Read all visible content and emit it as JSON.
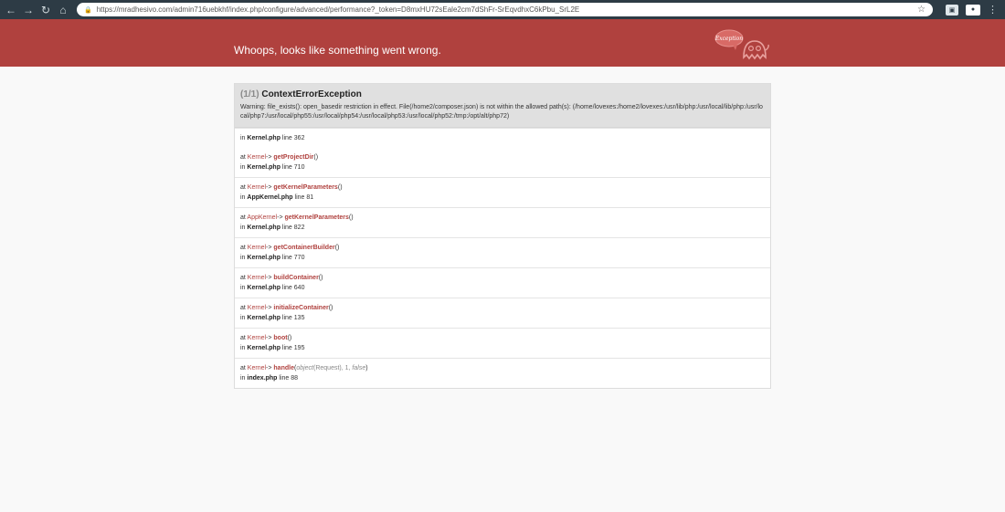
{
  "browser": {
    "back_icon": "arrow-left-icon",
    "url": "https://mradhesivo.com/admin716uebkhf/index.php/configure/advanced/performance?_token=D8mxHU72sEale2cm7dShFr-SrEqvdhxC6kPbu_SrL2E"
  },
  "header": {
    "title": "Whoops, looks like something went wrong.",
    "ghost_label": "Exception",
    "bg_color": "#b0413e"
  },
  "exception": {
    "count": "(1/1)",
    "name": "ContextErrorException",
    "message": "Warning: file_exists(): open_basedir restriction in effect. File(/home2/composer.json) is not within the allowed path(s): (/home/lovexes:/home2/lovexes:/usr/lib/php:/usr/local/lib/php:/usr/local/php7:/usr/local/php55:/usr/local/php54:/usr/local/php53:/usr/local/php52:/tmp:/opt/alt/php72)"
  },
  "trace": {
    "first": {
      "in_label": "in",
      "file": "Kernel.php",
      "line_label": "line",
      "line": "362"
    },
    "items": [
      {
        "at": "at",
        "cls": "Kernel",
        "arrow": "->",
        "fn": "getProjectDir",
        "paren_open": "(",
        "paren_close": ")",
        "in_label": "in",
        "file": "Kernel.php",
        "line_label": "line",
        "line": "710"
      },
      {
        "at": "at",
        "cls": "Kernel",
        "arrow": "->",
        "fn": "getKernelParameters",
        "paren_open": "(",
        "paren_close": ")",
        "in_label": "in",
        "file": "AppKernel.php",
        "line_label": "line",
        "line": "81"
      },
      {
        "at": "at",
        "cls": "AppKernel",
        "arrow": "->",
        "fn": "getKernelParameters",
        "paren_open": "(",
        "paren_close": ")",
        "in_label": "in",
        "file": "Kernel.php",
        "line_label": "line",
        "line": "822"
      },
      {
        "at": "at",
        "cls": "Kernel",
        "arrow": "->",
        "fn": "getContainerBuilder",
        "paren_open": "(",
        "paren_close": ")",
        "in_label": "in",
        "file": "Kernel.php",
        "line_label": "line",
        "line": "770"
      },
      {
        "at": "at",
        "cls": "Kernel",
        "arrow": "->",
        "fn": "buildContainer",
        "paren_open": "(",
        "paren_close": ")",
        "in_label": "in",
        "file": "Kernel.php",
        "line_label": "line",
        "line": "640"
      },
      {
        "at": "at",
        "cls": "Kernel",
        "arrow": "->",
        "fn": "initializeContainer",
        "paren_open": "(",
        "paren_close": ")",
        "in_label": "in",
        "file": "Kernel.php",
        "line_label": "line",
        "line": "135"
      },
      {
        "at": "at",
        "cls": "Kernel",
        "arrow": "->",
        "fn": "boot",
        "paren_open": "(",
        "paren_close": ")",
        "in_label": "in",
        "file": "Kernel.php",
        "line_label": "line",
        "line": "195"
      }
    ],
    "last": {
      "at": "at",
      "cls": "Kernel",
      "arrow": "->",
      "fn": "handle",
      "paren_open": "(",
      "arg_type": "object",
      "arg_obj": "(Request)",
      "sep": ", 1, ",
      "arg_false": "false",
      "paren_close": ")",
      "in_label": "in",
      "file": "index.php",
      "line_label": "line",
      "line": "88"
    }
  }
}
